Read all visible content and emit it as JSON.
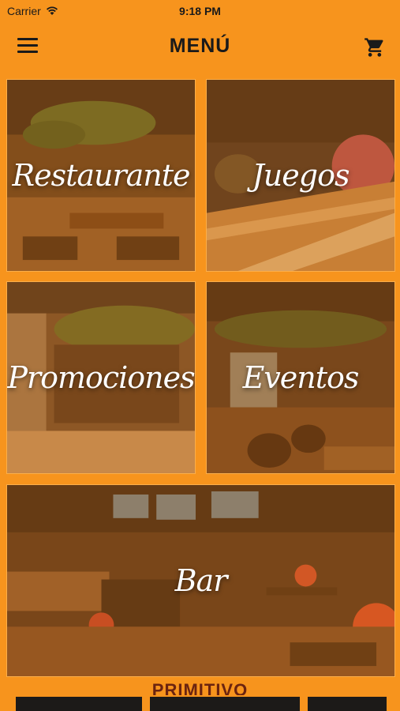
{
  "status_bar": {
    "carrier": "Carrier",
    "time": "9:18 PM"
  },
  "header": {
    "title": "MENÚ",
    "menu_icon": "hamburger-icon",
    "cart_icon": "shopping-cart-icon"
  },
  "tiles": [
    {
      "label": "Restaurante"
    },
    {
      "label": "Juegos"
    },
    {
      "label": "Promociones"
    },
    {
      "label": "Eventos"
    },
    {
      "label": "Bar"
    }
  ],
  "brand": {
    "name": "PRIMITIVO"
  },
  "colors": {
    "accent": "#f7941d",
    "brand_text": "#6b2410"
  }
}
